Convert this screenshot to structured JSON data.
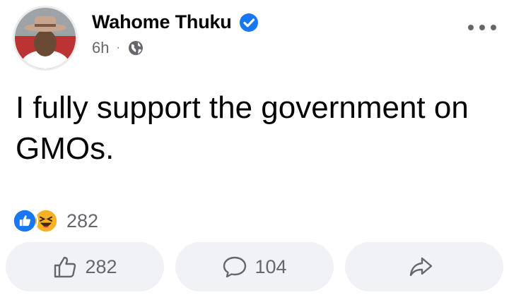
{
  "post": {
    "author": "Wahome Thuku",
    "time": "6h",
    "separator": "·",
    "privacy_icon": "globe-icon",
    "text": "I fully support the government on GMOs.",
    "reaction_count": "282",
    "reaction_icons": [
      "like-reaction-icon",
      "haha-reaction-icon"
    ]
  },
  "actions": {
    "like_count": "282",
    "comment_count": "104",
    "share_label": ""
  },
  "colors": {
    "verified": "#1877f2",
    "like": "#1877f2",
    "haha": "#f7b125",
    "secondary_text": "#65676b",
    "button_bg": "#f0f2f5"
  }
}
